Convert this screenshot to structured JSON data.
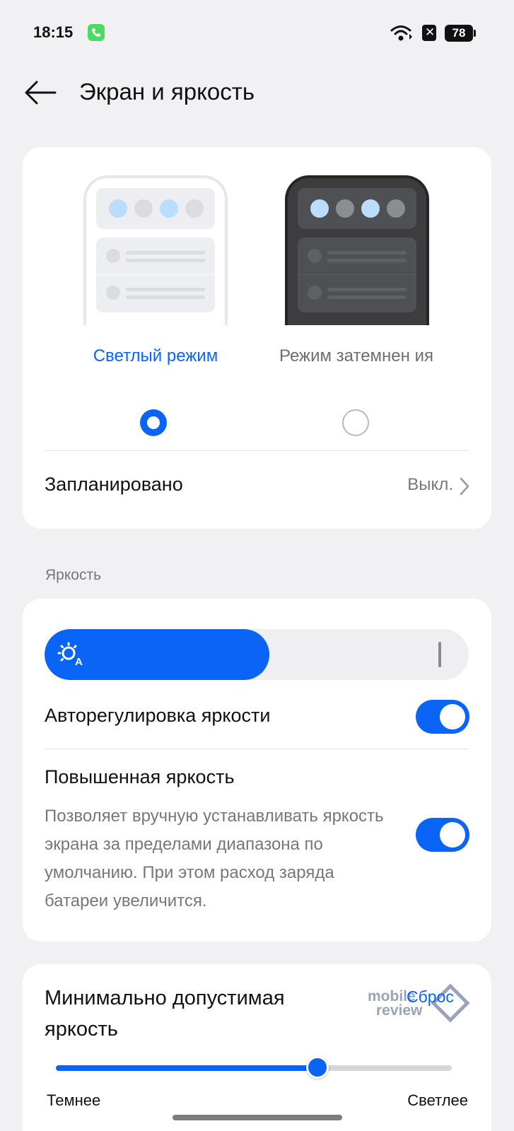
{
  "status_bar": {
    "time": "18:15",
    "battery": "78"
  },
  "header": {
    "title": "Экран и яркость"
  },
  "display_mode": {
    "light_label": "Светлый режим",
    "dark_label": "Режим затемнен ия",
    "selected": "light"
  },
  "schedule": {
    "label": "Запланировано",
    "value": "Выкл."
  },
  "brightness": {
    "section_label": "Яркость",
    "level": 0.53,
    "auto_label": "Авторегулировка яркости",
    "auto_enabled": true,
    "boost_label": "Повышенная яркость",
    "boost_description": "Позволяет вручную устанавливать яркость экрана за пределами диапазона по умолчанию. При этом расход заряда батареи увеличится.",
    "boost_enabled": true
  },
  "min_brightness": {
    "title": "Минимально допустимая яркость",
    "reset_label": "Сброс",
    "watermark_line1": "mobile",
    "watermark_line2": "review",
    "level": 0.66,
    "left_label": "Темнее",
    "right_label": "Светлее"
  },
  "colors": {
    "accent": "#0a64f5",
    "background": "#f1f1f3",
    "card": "#ffffff"
  }
}
